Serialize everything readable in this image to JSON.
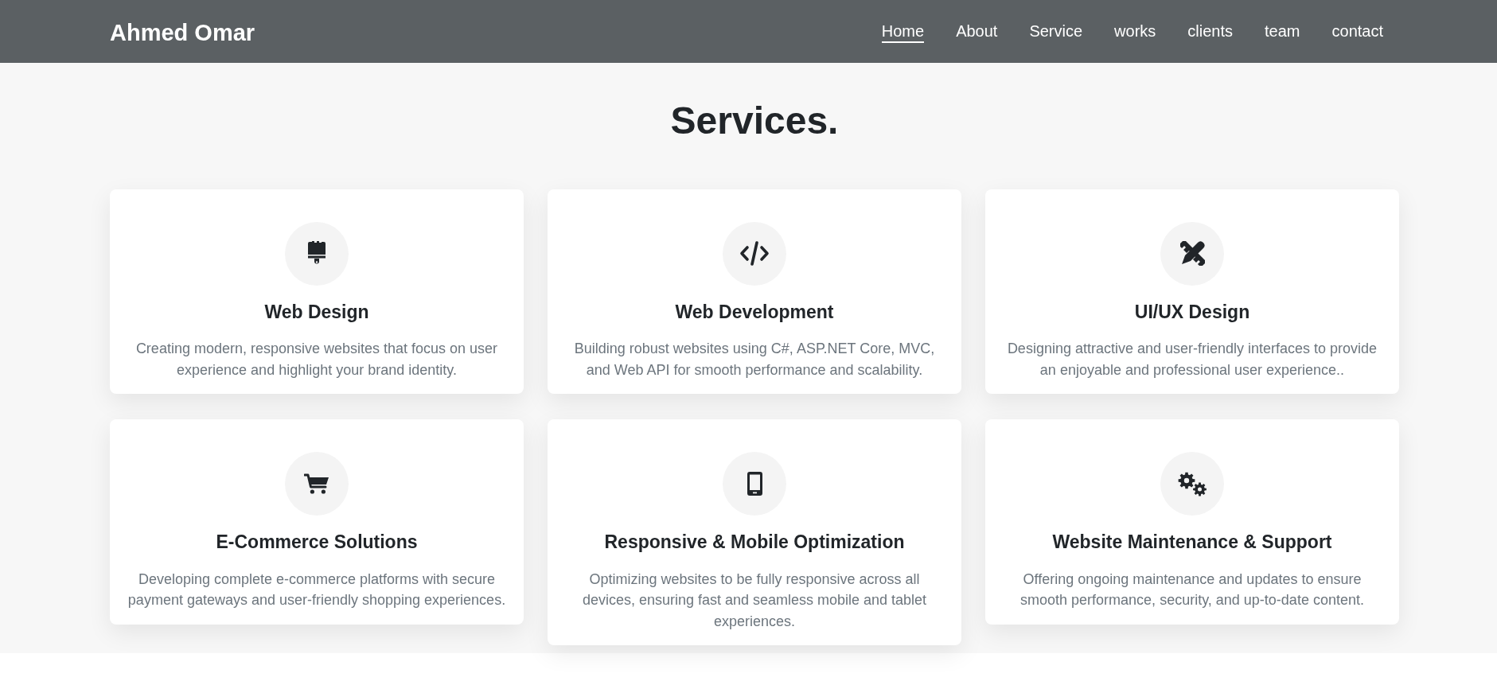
{
  "header": {
    "logo": "Ahmed Omar",
    "nav": [
      {
        "label": "Home",
        "selected": true
      },
      {
        "label": "About",
        "selected": false
      },
      {
        "label": "Service",
        "selected": false
      },
      {
        "label": "works",
        "selected": false
      },
      {
        "label": "clients",
        "selected": false
      },
      {
        "label": "team",
        "selected": false
      },
      {
        "label": "contact",
        "selected": false
      }
    ]
  },
  "services": {
    "title": "Services.",
    "cards": [
      {
        "title": "Web Design",
        "description": "Creating modern, responsive websites that focus on user experience and highlight your brand identity."
      },
      {
        "title": "Web Development",
        "description": "Building robust websites using C#, ASP.NET Core, MVC, and Web API for smooth performance and scalability."
      },
      {
        "title": "UI/UX Design",
        "description": "Designing attractive and user-friendly interfaces to provide an enjoyable and professional user experience.."
      },
      {
        "title": "E-Commerce Solutions",
        "description": "Developing complete e-commerce platforms with secure payment gateways and user-friendly shopping experiences."
      },
      {
        "title": "Responsive & Mobile Optimization",
        "description": "Optimizing websites to be fully responsive across all devices, ensuring fast and seamless mobile and tablet experiences."
      },
      {
        "title": "Website Maintenance & Support",
        "description": "Offering ongoing maintenance and updates to ensure smooth performance, security, and up-to-date content."
      }
    ]
  }
}
